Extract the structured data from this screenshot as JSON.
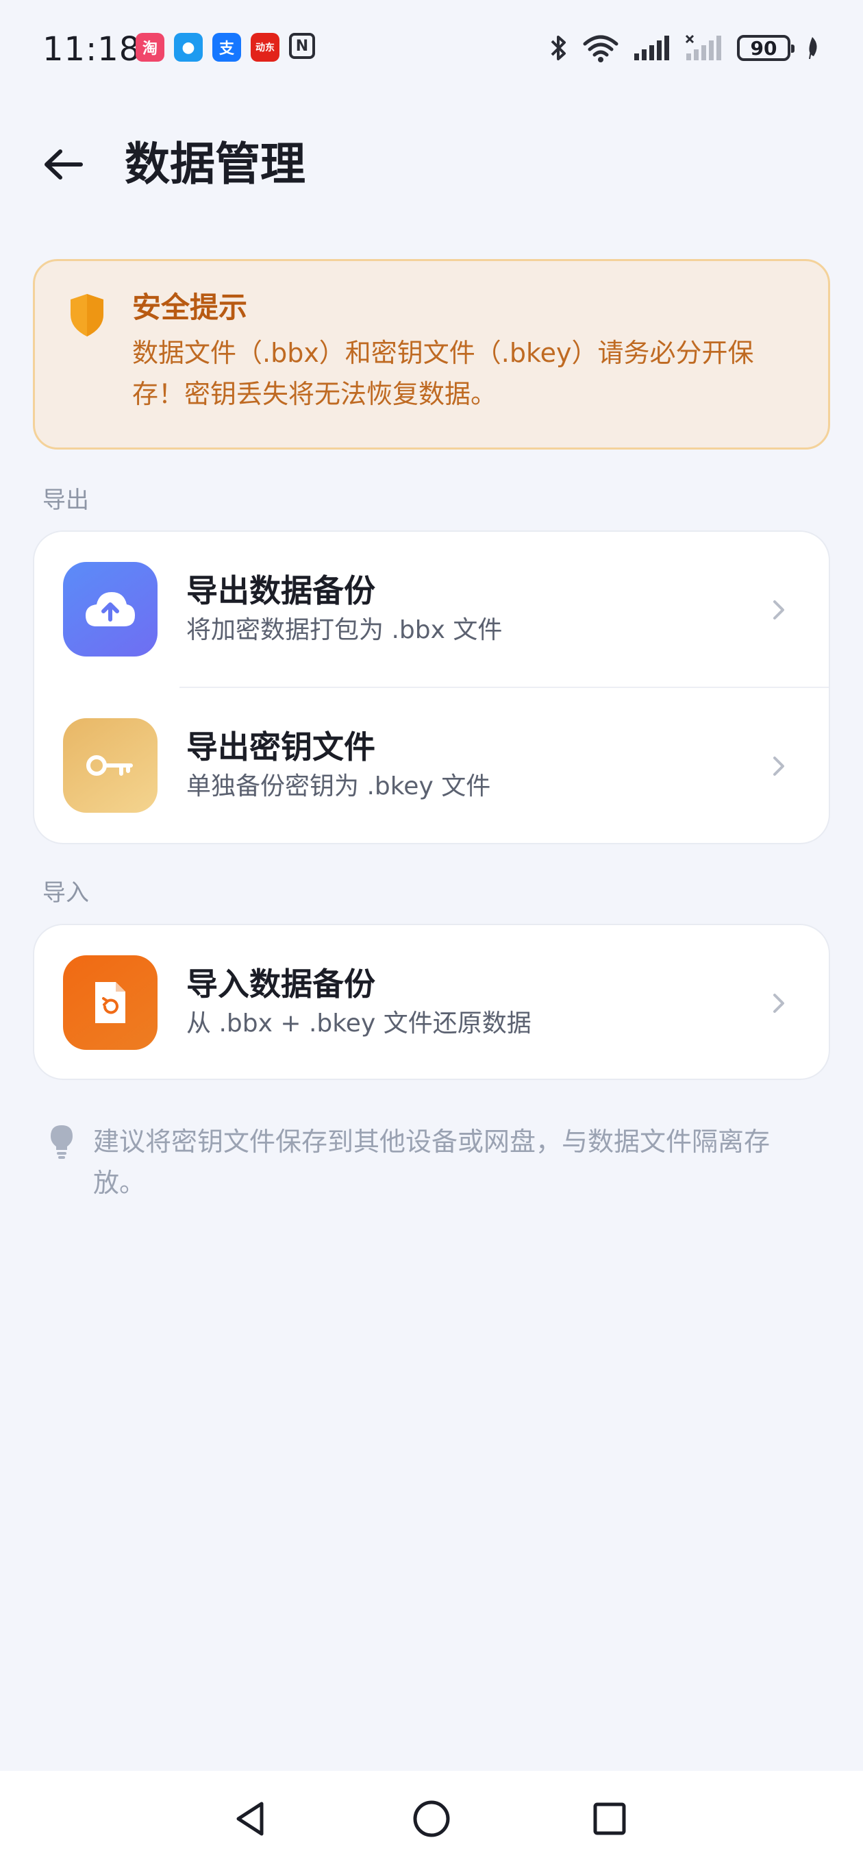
{
  "status_bar": {
    "time": "11:18",
    "battery": "90",
    "app_icons": [
      "game-app-icon",
      "messages-app-icon",
      "alipay-app-icon",
      "jd-app-icon",
      "nfc-icon"
    ],
    "app_icon_glyphs": {
      "pink": "淘",
      "blue1": "●",
      "blue2": "支",
      "red": "动东",
      "nfc": "N"
    }
  },
  "header": {
    "title": "数据管理"
  },
  "notice": {
    "title": "安全提示",
    "body": "数据文件（.bbx）和密钥文件（.bkey）请务必分开保存！密钥丢失将无法恢复数据。",
    "accent_color": "#b85a12"
  },
  "sections": {
    "export": {
      "label": "导出",
      "items": [
        {
          "title": "导出数据备份",
          "subtitle": "将加密数据打包为 .bbx 文件",
          "icon": "cloud-upload-icon"
        },
        {
          "title": "导出密钥文件",
          "subtitle": "单独备份密钥为 .bkey 文件",
          "icon": "key-icon"
        }
      ]
    },
    "import": {
      "label": "导入",
      "items": [
        {
          "title": "导入数据备份",
          "subtitle": "从 .bbx + .bkey 文件还原数据",
          "icon": "file-restore-icon"
        }
      ]
    }
  },
  "tip": {
    "text": "建议将密钥文件保存到其他设备或网盘，与数据文件隔离存放。",
    "icon": "lightbulb-icon"
  },
  "nav_bar": {
    "buttons": [
      "back-triangle-icon",
      "home-circle-icon",
      "recents-square-icon"
    ]
  }
}
